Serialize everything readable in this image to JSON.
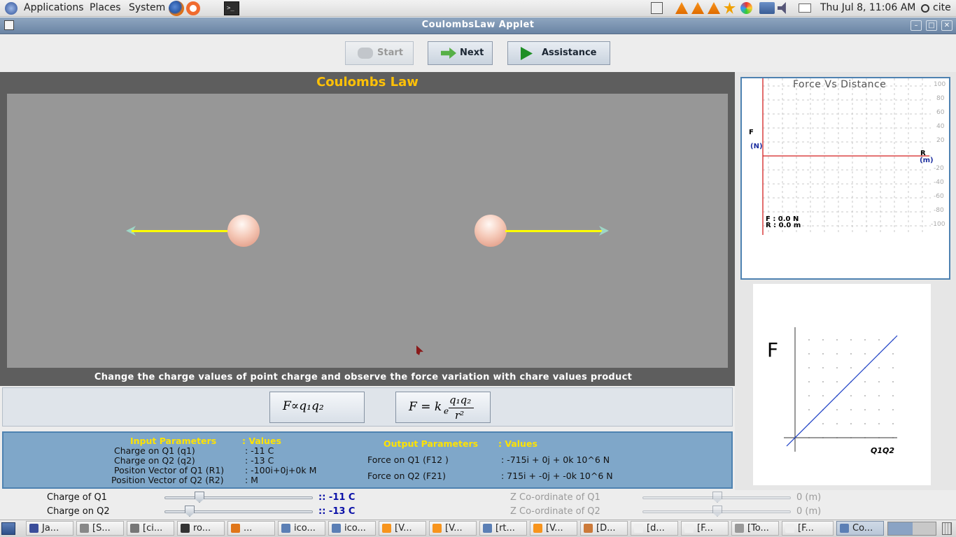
{
  "top_panel": {
    "menus": [
      "Applications",
      "Places",
      "System"
    ],
    "clock": "Thu Jul  8, 11:06 AM",
    "user": "cite"
  },
  "window": {
    "title": "CoulombsLaw Applet"
  },
  "toolbar": {
    "start_label": "Start",
    "next_label": "Next",
    "assistance_label": "Assistance"
  },
  "simulation": {
    "title": "Coulombs Law",
    "instruction": "Change the charge values of point charge and observe the force variation with chare values product"
  },
  "formulas": {
    "proportional": "F∝q₁q₂",
    "coulomb_lhs": "F = k",
    "coulomb_sub": "e",
    "coulomb_num": "q₁q₂",
    "coulomb_den": "r²"
  },
  "parameters": {
    "input_header": "Input Parameters",
    "values_header": ":  Values",
    "inputs": [
      {
        "label": "Charge on Q1 (q1)",
        "value": ": -11 C"
      },
      {
        "label": "Charge on Q2 (q2)",
        "value": ": -13 C"
      },
      {
        "label": "Positon Vector of Q1 (R1)",
        "value": ": -100i+0j+0k M"
      },
      {
        "label": "Position Vector of Q2 (R2)",
        "value": ":  M"
      }
    ],
    "output_header": "Output Parameters",
    "output_values_header": ": Values",
    "outputs": [
      {
        "label": "Force on Q1 (F12 )",
        "value": ": -715i + 0j + 0k  10^6 N"
      },
      {
        "label": "Force on Q2 (F21)",
        "value": ": 715i + -0j + -0k  10^6 N"
      }
    ]
  },
  "graph1": {
    "title": "Force  Vs Distance",
    "y_label": "F",
    "y_unit": "(N)",
    "x_label": "R",
    "x_unit": "(m)",
    "y_ticks_pos": [
      "100",
      "80",
      "60",
      "40",
      "20"
    ],
    "y_ticks_neg": [
      "-20",
      "-40",
      "-60",
      "-80",
      "-100"
    ],
    "readout_f": "F : 0.0 N",
    "readout_r": "R : 0.0 m"
  },
  "graph2": {
    "y_label": "F",
    "x_label": "Q1Q2"
  },
  "sliders": {
    "q1_label": "Charge of Q1",
    "q1_value": ":: -11 C",
    "q2_label": "Charge on Q2",
    "q2_value": ":: -13 C",
    "z1_label": "Z Co-ordinate of Q1",
    "z1_value": "0 (m)",
    "z2_label": "Z Co-ordinate of Q2",
    "z2_value": "0 (m)"
  },
  "taskbar": {
    "items": [
      "Ja...",
      "[S...",
      "[ci...",
      "ro...",
      "...",
      "ico...",
      "ico...",
      "[V...",
      "[V...",
      "[rt...",
      "[V...",
      "[D...",
      "[d...",
      "[F...",
      "[To...",
      "[F...",
      "Co..."
    ]
  }
}
